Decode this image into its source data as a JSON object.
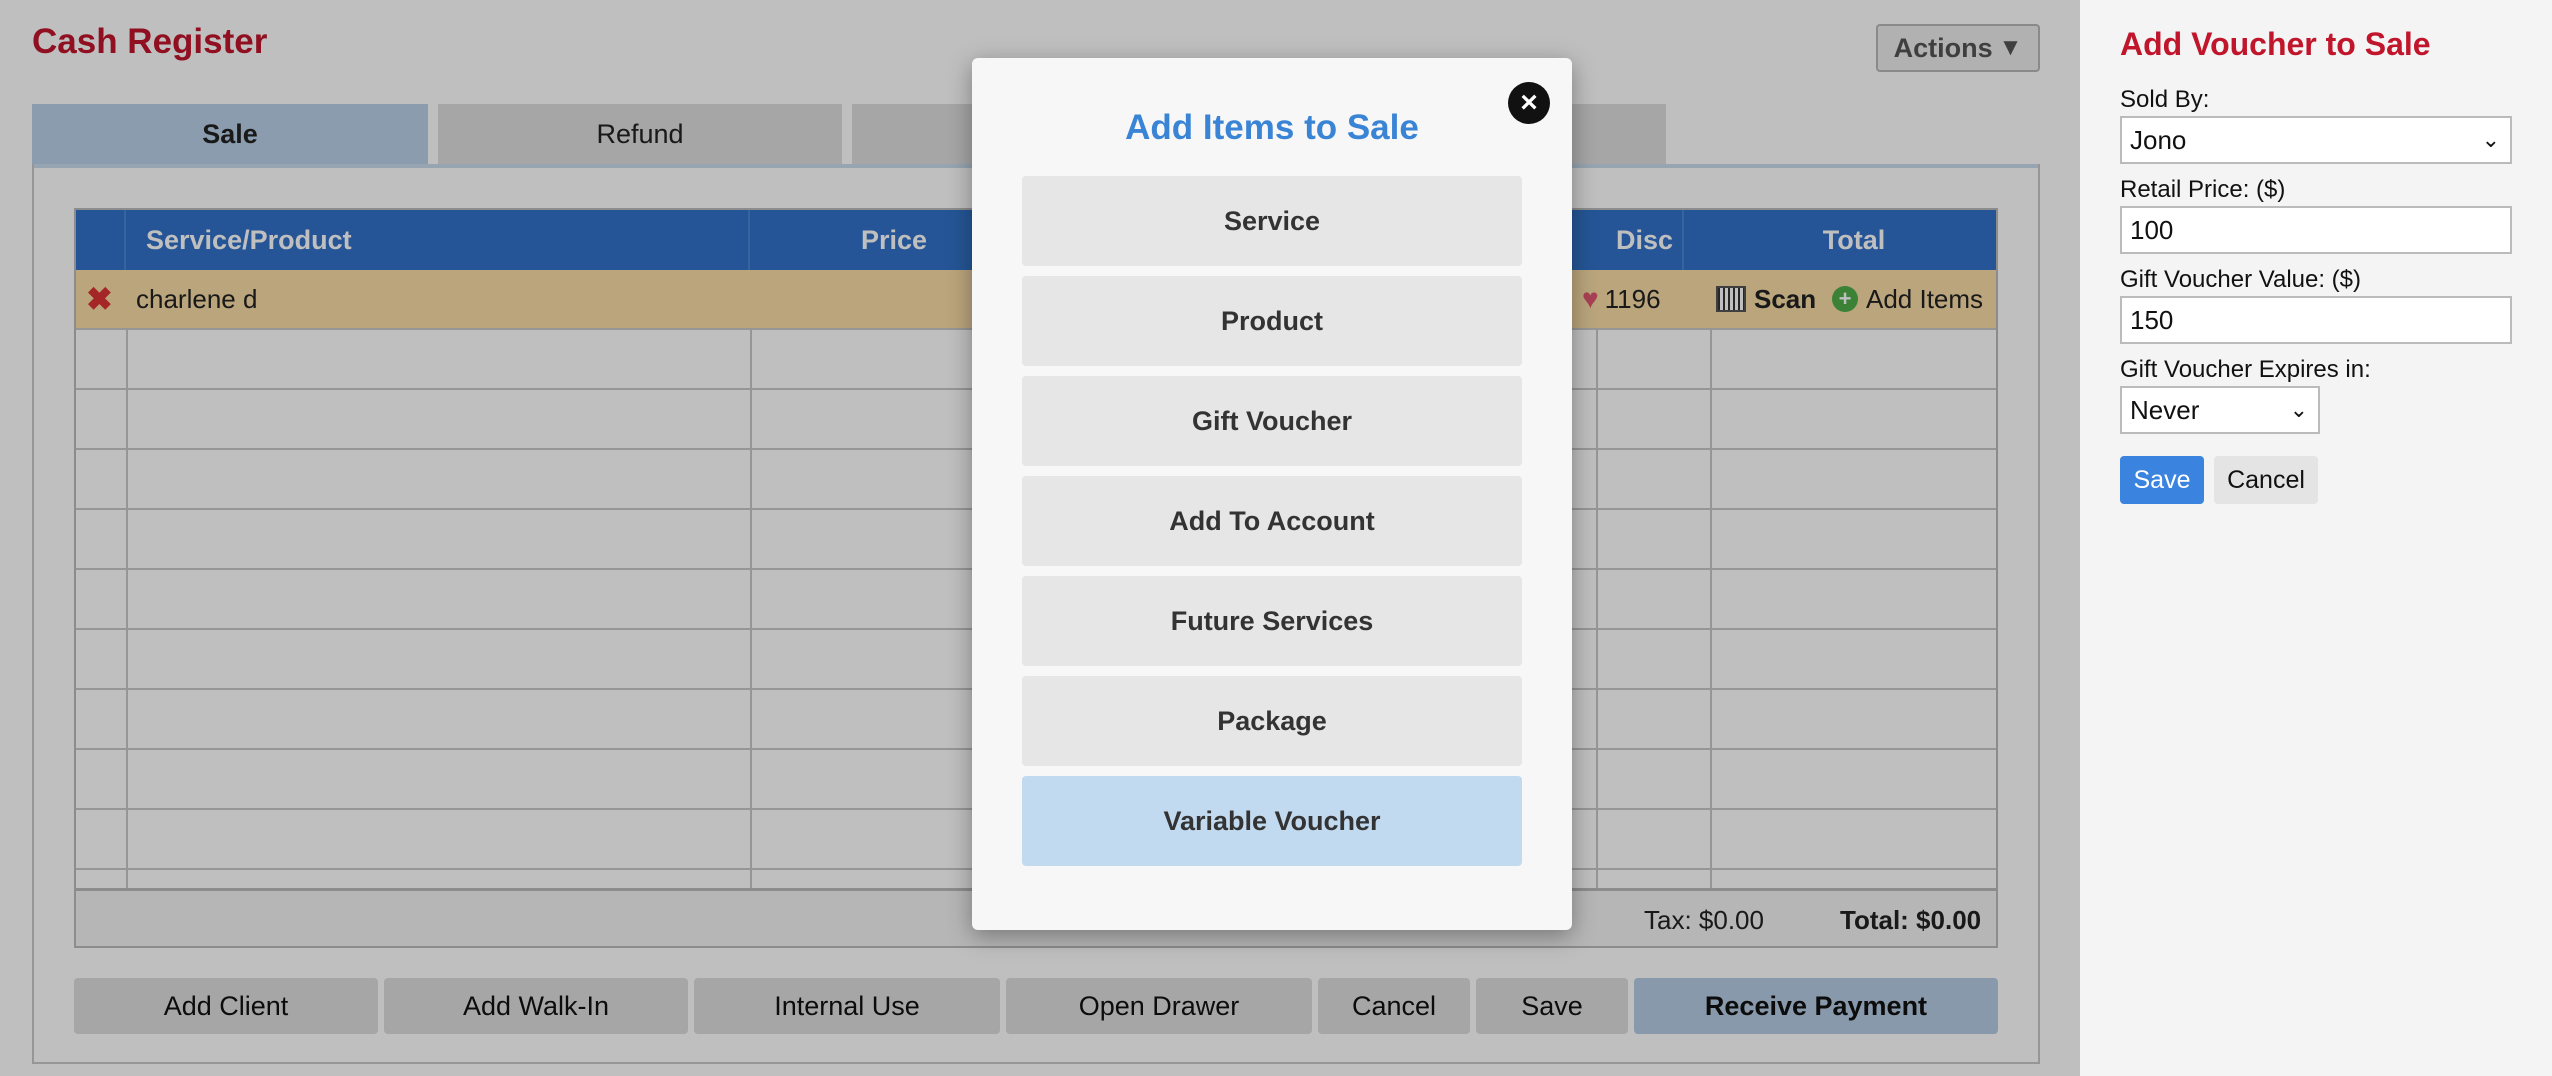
{
  "register": {
    "title": "Cash Register",
    "actions_label": "Actions",
    "tabs": [
      {
        "label": "Sale"
      },
      {
        "label": "Refund"
      },
      {
        "label": ""
      },
      {
        "label": ""
      }
    ],
    "table": {
      "columns": {
        "service": "Service/Product",
        "price": "Price",
        "disc": "Disc",
        "total": "Total"
      },
      "client_row": {
        "name": "charlene d",
        "points": "1196",
        "scan_label": "Scan",
        "add_items_label": "Add Items"
      },
      "tax": "Tax: $0.00",
      "total": "Total: $0.00"
    },
    "buttons": {
      "add_client": "Add Client",
      "add_walkin": "Add Walk-In",
      "internal_use": "Internal Use",
      "open_drawer": "Open Drawer",
      "cancel": "Cancel",
      "save": "Save",
      "receive_payment": "Receive Payment"
    }
  },
  "modal": {
    "title": "Add Items to Sale",
    "options": [
      {
        "label": "Service"
      },
      {
        "label": "Product"
      },
      {
        "label": "Gift Voucher"
      },
      {
        "label": "Add To Account"
      },
      {
        "label": "Future Services"
      },
      {
        "label": "Package"
      },
      {
        "label": "Variable Voucher"
      }
    ]
  },
  "side_panel": {
    "title": "Add Voucher to Sale",
    "sold_by_label": "Sold By:",
    "sold_by_value": "Jono",
    "retail_price_label": "Retail Price: ($)",
    "retail_price_value": "100",
    "voucher_value_label": "Gift Voucher Value: ($)",
    "voucher_value_value": "150",
    "expires_label": "Gift Voucher Expires in:",
    "expires_value": "Never",
    "save_label": "Save",
    "cancel_label": "Cancel"
  },
  "colors": {
    "brand_red": "#c0152b",
    "header_blue": "#3272c8",
    "accent_blue": "#3a84d6"
  }
}
